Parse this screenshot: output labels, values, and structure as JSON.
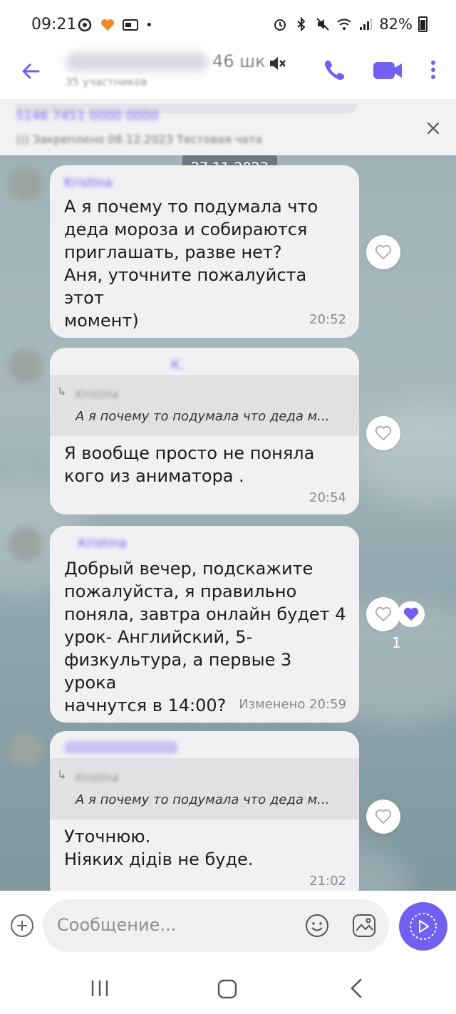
{
  "status_bar": {
    "time": "09:21",
    "battery": "82%",
    "dot": "•"
  },
  "header": {
    "title_suffix": "46 шк",
    "subtitle": "35 участников"
  },
  "pinned": {
    "line1": "5146 7451 0000 0000",
    "line2": "))) Закреплено 08.12.2023 Тестовая чата"
  },
  "chat": {
    "date_divider": "27.11.2023",
    "messages": [
      {
        "author": "Kristina",
        "text": "А я почему то подумала что\nдеда мороза и собираются\nприглашать, разве нет?\nАня, уточните пожалуйста этот\nмомент)",
        "time": "20:52"
      },
      {
        "author": "К.",
        "reply_author": "Kristina",
        "reply_text": "А я почему то подумала что деда м...",
        "text": "Я вообще просто не поняла\nкого из аниматора .",
        "time": "20:54"
      },
      {
        "author": "Kristina",
        "text": "Добрый вечер, подскажите\nпожалуйста, я правильно\nпоняла, завтра онлайн будет 4\nурок- Английский, 5-\nфизкультура, а первые 3 урока\nначнутся в 14:00?",
        "time": "Изменено  20:59",
        "likes": "1"
      },
      {
        "author": "",
        "reply_author": "Kristina",
        "reply_text": "А я почему то подумала что деда м...",
        "text": "Уточнюю.\nНіяких дідів не буде.",
        "time": "21:02"
      }
    ]
  },
  "input": {
    "placeholder": "Сообщение..."
  },
  "colors": {
    "accent": "#7360f2",
    "bubble": "#f1f1f3",
    "chat_bg": "#9fb3b8"
  }
}
